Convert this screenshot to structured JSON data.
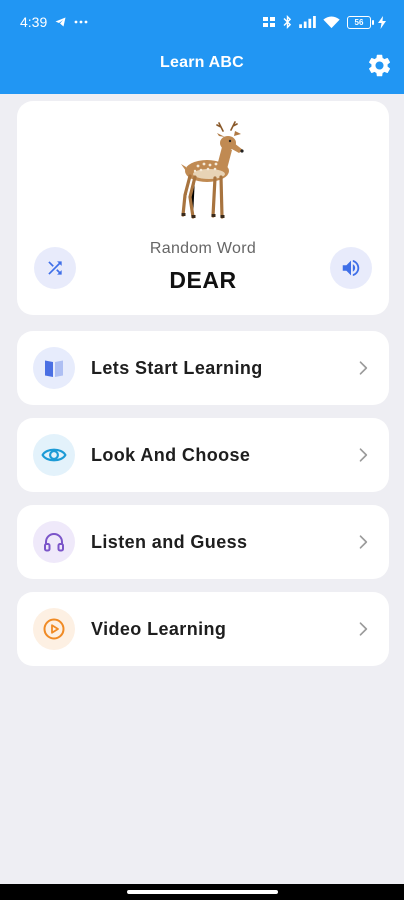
{
  "status_bar": {
    "time": "4:39",
    "battery": "56",
    "icons": [
      "telegram-icon",
      "more-dots-icon",
      "volte-icon",
      "bluetooth-icon",
      "signal-icon",
      "wifi-icon",
      "battery-icon",
      "charging-icon"
    ]
  },
  "app_bar": {
    "title": "Learn ABC",
    "settings_icon": "gear-icon",
    "background": "#2196f3"
  },
  "word_card": {
    "image": "deer-icon",
    "label": "Random Word",
    "word": "DEAR",
    "shuffle_icon": "shuffle-icon",
    "sound_icon": "speaker-icon"
  },
  "menu": {
    "items": [
      {
        "label": "Lets Start Learning",
        "icon": "book-icon",
        "icon_color": "#4a6fe3",
        "icon_bg": "#e7ecfc"
      },
      {
        "label": "Look And Choose",
        "icon": "eye-icon",
        "icon_color": "#1d9bd6",
        "icon_bg": "#e3f2fb"
      },
      {
        "label": "Listen and Guess",
        "icon": "headphones-icon",
        "icon_color": "#7b55c9",
        "icon_bg": "#efe9fa"
      },
      {
        "label": "Video Learning",
        "icon": "play-circle-icon",
        "icon_color": "#f08a24",
        "icon_bg": "#fdf0e3"
      }
    ]
  }
}
